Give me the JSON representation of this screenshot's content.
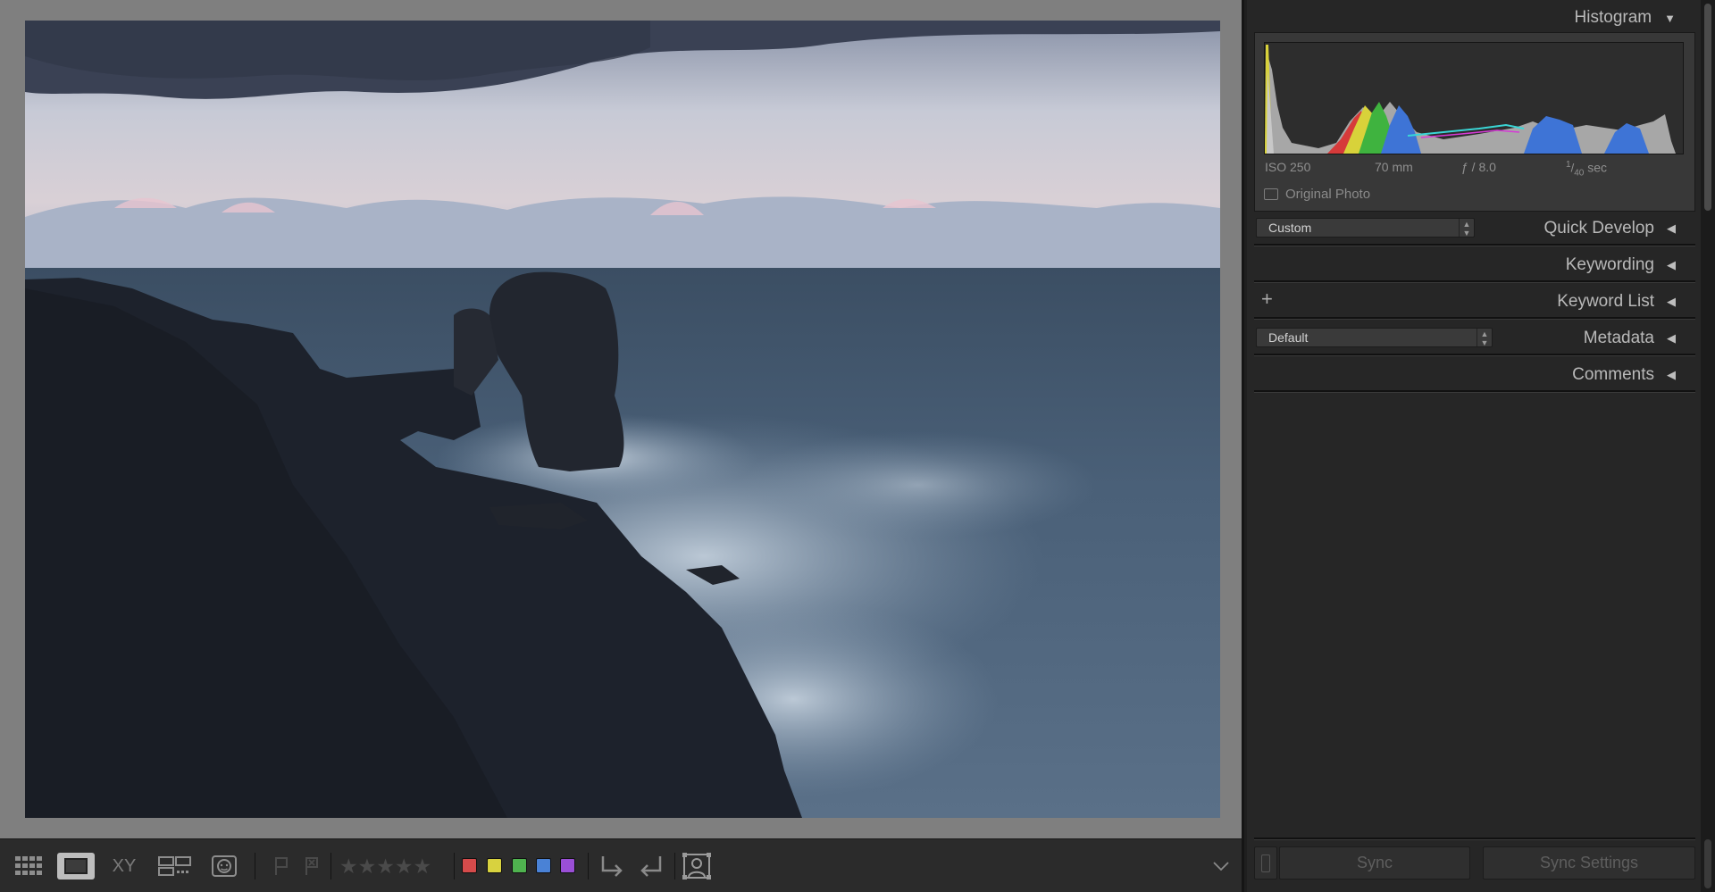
{
  "toolbar": {
    "view_buttons": [
      {
        "name": "grid-view-button",
        "label": ""
      },
      {
        "name": "loupe-view-button",
        "label": ""
      },
      {
        "name": "compare-view-button",
        "label": "XY"
      },
      {
        "name": "survey-view-button",
        "label": ""
      },
      {
        "name": "people-view-button",
        "label": ""
      }
    ],
    "stars": "★★★★★",
    "color_labels": [
      "#d64b4b",
      "#d8d23f",
      "#4fb34f",
      "#4a82d6",
      "#9a4fd6"
    ]
  },
  "right_panel": {
    "histogram": {
      "title": "Histogram",
      "iso": "ISO 250",
      "focal_length": "70 mm",
      "aperture": "ƒ / 8.0",
      "shutter_num": "1",
      "shutter_den": "40",
      "shutter_unit": "sec",
      "original_photo_label": "Original Photo"
    },
    "quick_develop": {
      "title": "Quick Develop",
      "preset": "Custom"
    },
    "keywording": {
      "title": "Keywording"
    },
    "keyword_list": {
      "title": "Keyword List",
      "add_symbol": "+"
    },
    "metadata": {
      "title": "Metadata",
      "preset": "Default"
    },
    "comments": {
      "title": "Comments"
    },
    "sync": {
      "sync_label": "Sync",
      "sync_settings_label": "Sync Settings"
    }
  },
  "photo": {
    "description_hidden": true
  }
}
